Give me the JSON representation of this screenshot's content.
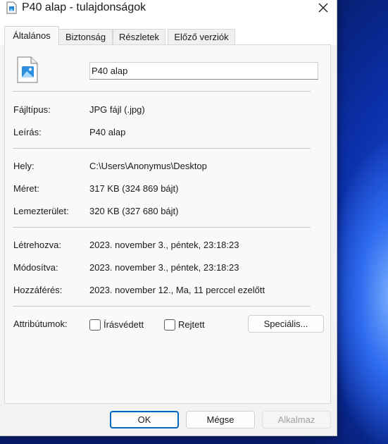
{
  "window": {
    "title": "P40 alap - tulajdonságok"
  },
  "tabs": [
    {
      "label": "Általános",
      "active": true
    },
    {
      "label": "Biztonság"
    },
    {
      "label": "Részletek"
    },
    {
      "label": "Előző verziók"
    }
  ],
  "file": {
    "name": "P40 alap",
    "icon": "image-file-icon"
  },
  "properties": {
    "type": {
      "label": "Fájltípus:",
      "value": "JPG fájl (.jpg)"
    },
    "description": {
      "label": "Leírás:",
      "value": "P40 alap"
    },
    "location": {
      "label": "Hely:",
      "value": "C:\\Users\\Anonymus\\Desktop"
    },
    "size": {
      "label": "Méret:",
      "value": "317 KB (324 869 bájt)"
    },
    "size_on_disk": {
      "label": "Lemezterület:",
      "value": "320 KB (327 680 bájt)"
    },
    "created": {
      "label": "Létrehozva:",
      "value": "2023. november 3., péntek, 23:18:23"
    },
    "modified": {
      "label": "Módosítva:",
      "value": "2023. november 3., péntek, 23:18:23"
    },
    "accessed": {
      "label": "Hozzáférés:",
      "value": "2023. november 12., Ma, 11 perccel ezelőtt"
    }
  },
  "attributes": {
    "label": "Attribútumok:",
    "readonly": {
      "label": "Írásvédett",
      "checked": false
    },
    "hidden": {
      "label": "Rejtett",
      "checked": false
    },
    "advanced_label": "Speciális..."
  },
  "buttons": {
    "ok": "OK",
    "cancel": "Mégse",
    "apply": "Alkalmaz"
  },
  "colors": {
    "accent": "#0067c0",
    "dialog_bg": "#f3f3f3",
    "panel_bg": "#f9f9f9"
  }
}
